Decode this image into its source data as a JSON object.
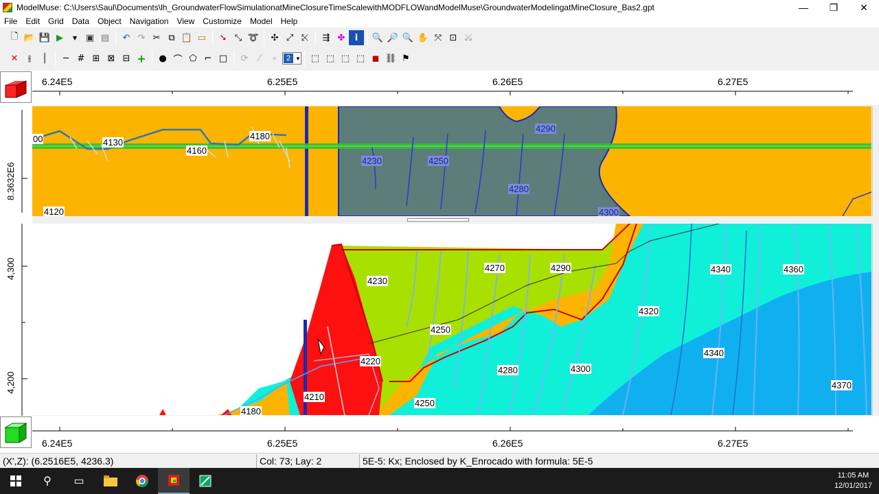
{
  "window": {
    "title": "ModelMuse: C:\\Users\\Saul\\Documents\\lh_GroundwaterFlowSimulationatMineClosureTimeScalewithMODFLOWandModelMuse\\GroundwaterModelingatMineClosure_Bas2.gpt",
    "minimize": "—",
    "restore": "❐",
    "close": "✕"
  },
  "menu": [
    "File",
    "Edit",
    "Grid",
    "Data",
    "Object",
    "Navigation",
    "View",
    "Customize",
    "Model",
    "Help"
  ],
  "toolbar2": {
    "layer_value": "2"
  },
  "axes": {
    "x_ticks": [
      "6.24E5",
      "6.25E5",
      "6.26E5",
      "6.27E5"
    ],
    "plan_y_label": "8.3632E6",
    "section_z_labels": [
      "4,300",
      "4,200"
    ]
  },
  "plan_view": {
    "contour_labels": [
      "00",
      "4130",
      "4160",
      "4180",
      "4120"
    ],
    "blue_labels": [
      "4290",
      "4230",
      "4250",
      "4280",
      "4300"
    ]
  },
  "section_view": {
    "contour_labels": [
      "4230",
      "4270",
      "4290",
      "4340",
      "4360",
      "4320",
      "4250",
      "4220",
      "4340",
      "4280",
      "4300",
      "4210",
      "4250",
      "4370",
      "4180"
    ]
  },
  "status": {
    "coords": "(X',Z): (6.2516E5, 4236.3)",
    "cell": "Col: 73; Lay: 2",
    "info": "5E-5: Kx; Enclosed by K_Enrocado with formula: 5E-5"
  },
  "taskbar": {
    "time": "11:05 AM",
    "date": "12/01/2017"
  },
  "colors": {
    "orange": "#fcb400",
    "gray_zone": "#5d7d7a",
    "red": "#ff1010",
    "lime": "#a8e000",
    "cyan": "#10f0d8",
    "blue_zone": "#10b0f0"
  }
}
